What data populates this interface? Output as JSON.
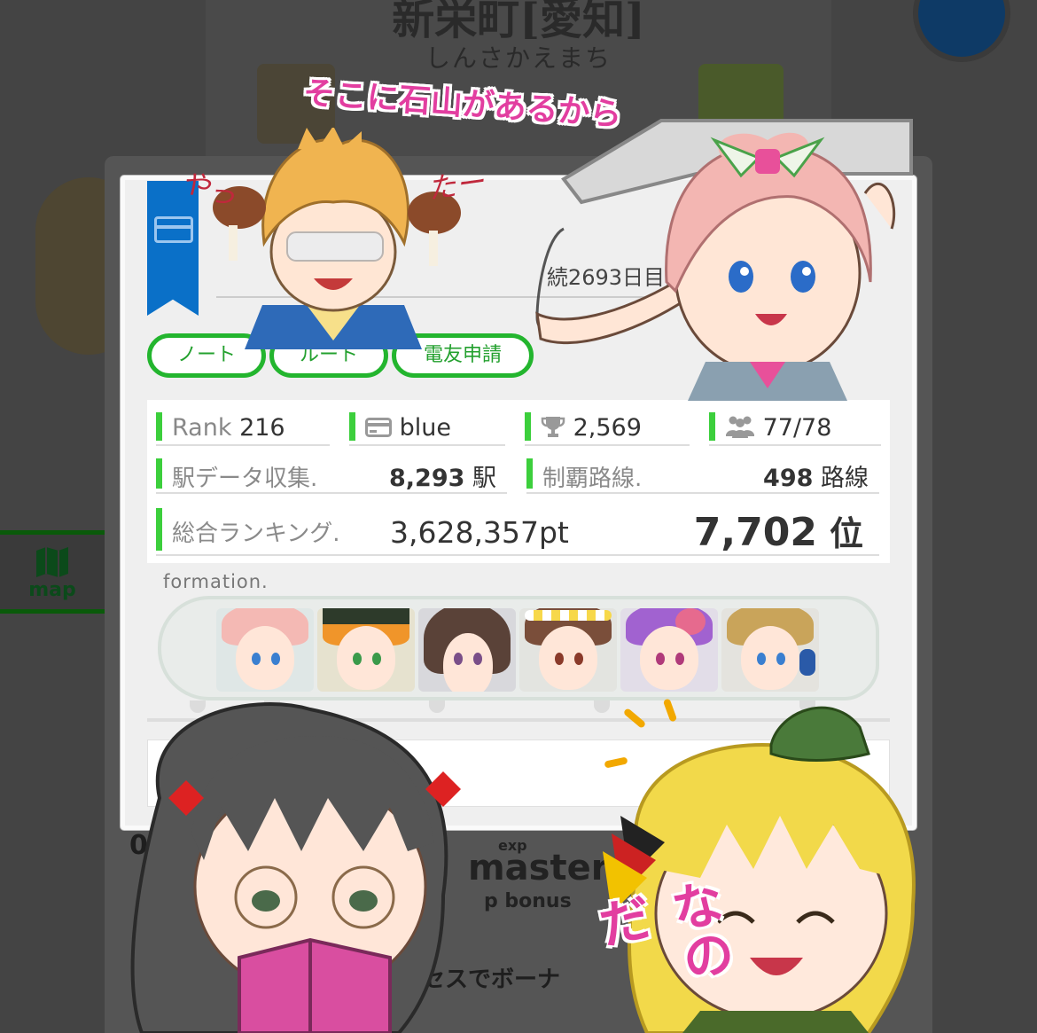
{
  "background": {
    "station_name": "新栄町[愛知]",
    "station_kana": "しんさかえまち",
    "map_tab_label": "map",
    "lower_labels": [
      "exp",
      "master",
      "p bonus",
      "クセスでボーナ"
    ]
  },
  "profile": {
    "username_suffix": "続2693日目）",
    "buttons": [
      "ノート",
      "ルート",
      "電友申請"
    ],
    "stats": {
      "rank_label": "Rank",
      "rank_value": "216",
      "card_color": "blue",
      "trophy_count": "2,569",
      "friends": "77/78",
      "station_label": "駅データ収集.",
      "station_value": "8,293",
      "station_unit": "駅",
      "route_label": "制覇路線.",
      "route_value": "498",
      "route_unit": "路線",
      "ranking_label": "総合ランキング.",
      "points": "3,628,357",
      "points_unit": "pt",
      "position": "7,702",
      "position_unit": "位"
    },
    "formation_label": "formation."
  },
  "overlay": {
    "speech_top": "そこに石山があるから",
    "scribble_left": "やっ",
    "scribble_right": "たー",
    "nanoda": "なのだ"
  },
  "colors": {
    "accent_green": "#23b52e",
    "ribbon_blue": "#0a70c8",
    "speech_pink": "#e23ea0"
  }
}
